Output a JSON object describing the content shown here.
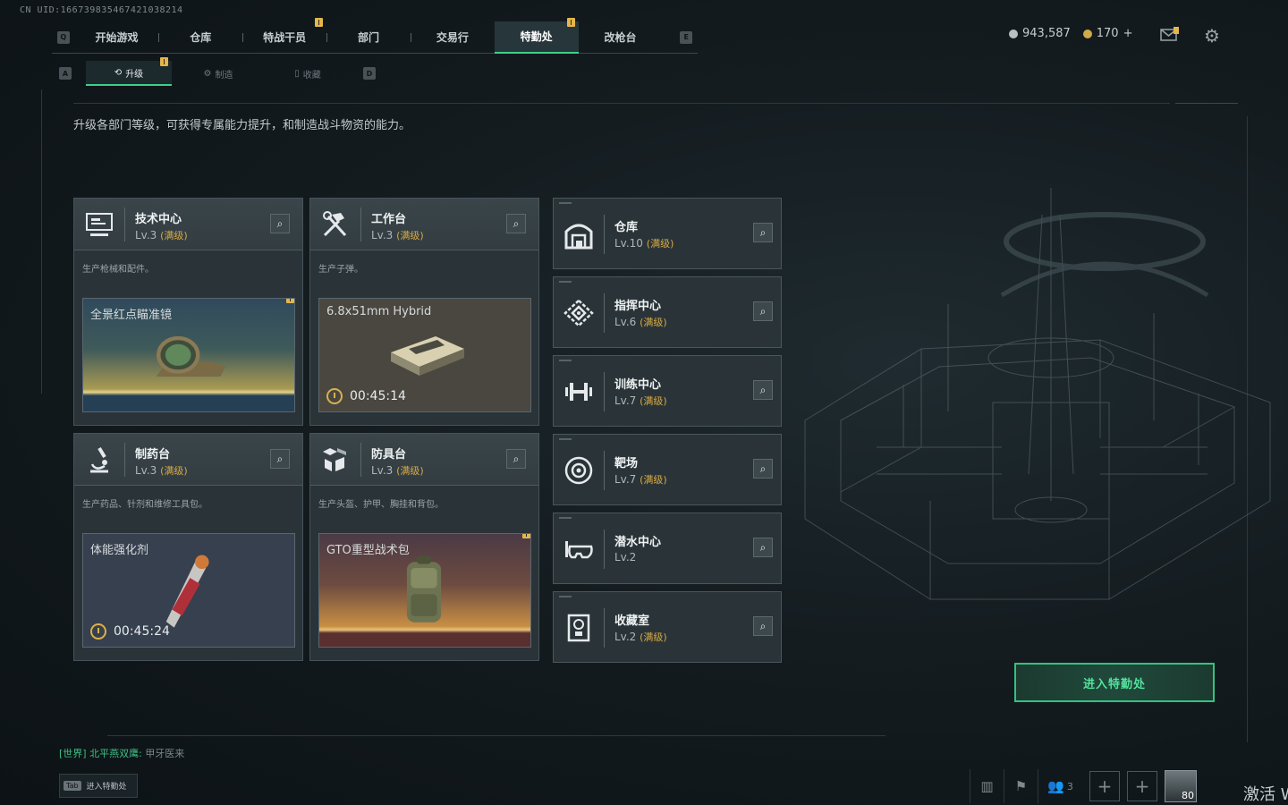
{
  "uid": "CN UID:1667398354674210382​14",
  "nav": {
    "key_left": "Q",
    "key_right": "E",
    "tabs": [
      {
        "label": "开始游戏",
        "badge": false,
        "active": false
      },
      {
        "label": "仓库",
        "badge": false,
        "active": false
      },
      {
        "label": "特战干员",
        "badge": true,
        "active": false
      },
      {
        "label": "部门",
        "badge": false,
        "active": false
      },
      {
        "label": "交易行",
        "badge": false,
        "active": false
      },
      {
        "label": "特勤处",
        "badge": true,
        "active": true
      },
      {
        "label": "改枪台",
        "badge": false,
        "active": false
      }
    ]
  },
  "subnav": {
    "key_left": "A",
    "key_right": "D",
    "tabs": [
      {
        "label": "升级",
        "icon": "upgrade-icon",
        "active": true,
        "badge": true
      },
      {
        "label": "制造",
        "icon": "craft-icon",
        "active": false,
        "badge": false
      },
      {
        "label": "收藏",
        "icon": "collection-icon",
        "active": false,
        "badge": false
      }
    ]
  },
  "currency": {
    "silver": "943,587",
    "gold": "170",
    "gold_plus": "+"
  },
  "description": "升级各部门等级，可获得专属能力提升，和制造战斗物资的能力。",
  "buildings": [
    {
      "name": "技术中心",
      "level": "Lv.3",
      "max": "(满级)",
      "desc": "生产枪械和配件。",
      "product": "全景红点瞄准镜",
      "timer": "",
      "badge": true
    },
    {
      "name": "工作台",
      "level": "Lv.3",
      "max": "(满级)",
      "desc": "生产子弹。",
      "product": "6.8x51mm Hybrid",
      "timer": "00:45:14",
      "badge": false
    },
    {
      "name": "制药台",
      "level": "Lv.3",
      "max": "(满级)",
      "desc": "生产药品、针剂和维修工具包。",
      "product": "体能强化剂",
      "timer": "00:45:24",
      "badge": false
    },
    {
      "name": "防具台",
      "level": "Lv.3",
      "max": "(满级)",
      "desc": "生产头盔、护甲、胸挂和背包。",
      "product": "GTO重型战术包",
      "timer": "",
      "badge": true
    }
  ],
  "facilities": [
    {
      "name": "仓库",
      "level": "Lv.10",
      "max": "(满级)",
      "icon": "warehouse-icon"
    },
    {
      "name": "指挥中心",
      "level": "Lv.6",
      "max": "(满级)",
      "icon": "command-icon"
    },
    {
      "name": "训练中心",
      "level": "Lv.7",
      "max": "(满级)",
      "icon": "dumbbell-icon"
    },
    {
      "name": "靶场",
      "level": "Lv.7",
      "max": "(满级)",
      "icon": "target-icon"
    },
    {
      "name": "潜水中心",
      "level": "Lv.2",
      "max": "",
      "icon": "diving-mask-icon"
    },
    {
      "name": "收藏室",
      "level": "Lv.2",
      "max": "(满级)",
      "icon": "trophy-icon"
    }
  ],
  "enter_button": "进入特勤处",
  "chat": {
    "channel": "[世界]",
    "sender": "北平燕双鹰:",
    "message": "甲牙医来"
  },
  "tab_hint": {
    "key": "Tab",
    "label": "进入特勤处"
  },
  "bottom_bar": {
    "friends_count": "3",
    "player_level": "80"
  },
  "activate_text": "激活 W",
  "colors": {
    "accent_green": "#3ed08a",
    "badge_yellow": "#e5b64a",
    "max_level_gold": "#d7a944"
  }
}
